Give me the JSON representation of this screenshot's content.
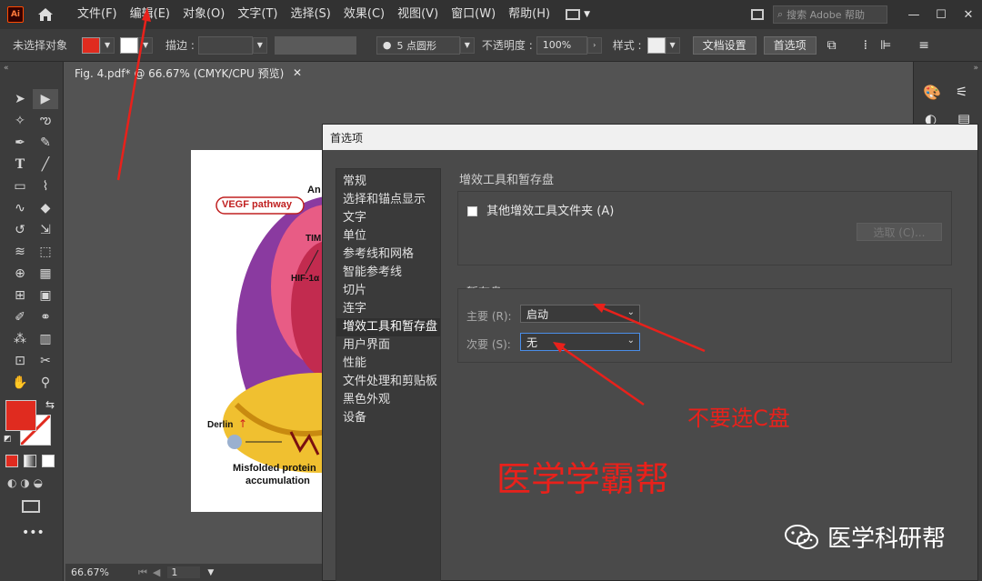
{
  "app": {
    "logo": "Ai",
    "menus": [
      "文件(F)",
      "编辑(E)",
      "对象(O)",
      "文字(T)",
      "选择(S)",
      "效果(C)",
      "视图(V)",
      "窗口(W)",
      "帮助(H)"
    ],
    "search_placeholder": "搜索 Adobe 帮助"
  },
  "control_bar": {
    "no_selection": "未选择对象",
    "stroke_label": "描边 :",
    "brush_label": "5 点圆形",
    "opacity_label": "不透明度 :",
    "opacity_value": "100%",
    "style_label": "样式 :",
    "doc_setup_button": "文档设置",
    "prefs_button": "首选项"
  },
  "document": {
    "tab_title": "Fig. 4.pdf* @ 66.67% (CMYK/CPU 预览)",
    "zoom": "66.67%",
    "page": "1"
  },
  "artwork": {
    "vegf": "VEGF pathway",
    "an": "An",
    "tim": "TIM",
    "hif": "HIF-1α",
    "derlin": "Derlin",
    "misfolded": "Misfolded protein",
    "accumulation": "accumulation"
  },
  "dialog": {
    "title": "首选项",
    "nav": [
      "常规",
      "选择和锚点显示",
      "文字",
      "单位",
      "参考线和网格",
      "智能参考线",
      "切片",
      "连字",
      "增效工具和暂存盘",
      "用户界面",
      "性能",
      "文件处理和剪贴板",
      "黑色外观",
      "设备"
    ],
    "selected_index": 8,
    "plugins_title": "增效工具和暂存盘",
    "other_plugins": "其他增效工具文件夹 (A)",
    "choose_button": "选取 (C)...",
    "scratch_title": "暂存盘",
    "primary_label": "主要 (R):",
    "primary_value": "启动",
    "secondary_label": "次要 (S):",
    "secondary_value": "无"
  },
  "annotations": {
    "note": "不要选C盘",
    "watermark": "医学学霸帮",
    "brand": "医学科研帮"
  },
  "colors": {
    "fill": "#e02b1f",
    "annotation": "#e8211b"
  }
}
